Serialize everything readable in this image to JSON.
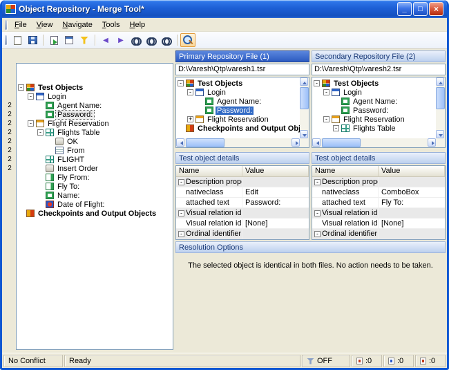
{
  "colors": {
    "titlebar_blue": "#1D5FD6",
    "selection_blue": "#316AC5",
    "primary_header_blue": "#2C5BC0",
    "light_header_blue": "#BCD0EE",
    "panel_face": "#ECE9D8"
  },
  "window": {
    "title": "Object Repository - Merge Tool*",
    "minimize_glyph": "_",
    "maximize_glyph": "□",
    "close_glyph": "×",
    "menu": [
      "File",
      "View",
      "Navigate",
      "Tools",
      "Help"
    ]
  },
  "toolbar": {
    "buttons": [
      {
        "dn": "new-icon",
        "cls": "tb-new"
      },
      {
        "dn": "save-icon",
        "cls": "tb-save"
      },
      {
        "dn": "toolbar-separator",
        "state": "tbsep",
        "ni": true
      },
      {
        "dn": "export-icon",
        "cls": "tb-doc"
      },
      {
        "dn": "statistics-icon",
        "cls": "tb-report"
      },
      {
        "dn": "filter-icon",
        "cls": "tb-filter"
      },
      {
        "dn": "toolbar-separator",
        "state": "tbsep",
        "ni": true
      },
      {
        "dn": "previous-conflict-icon",
        "cls": "tb-prev",
        "glyph": "◀"
      },
      {
        "dn": "next-conflict-icon",
        "cls": "tb-next",
        "glyph": "▶"
      },
      {
        "dn": "find-icon",
        "cls": "tb-find"
      },
      {
        "dn": "find-next-icon",
        "cls": "tb-find"
      },
      {
        "dn": "find-previous-icon",
        "cls": "tb-find"
      },
      {
        "dn": "toolbar-separator",
        "state": "tbsep",
        "ni": true
      },
      {
        "dn": "zoom-icon",
        "cls": "tb-zoom",
        "state": "active"
      }
    ]
  },
  "left_tree": {
    "gutter": [
      "",
      "",
      "2",
      "2",
      "2",
      "2",
      "2",
      "2",
      "2",
      "2",
      "",
      "",
      "",
      "",
      ""
    ],
    "rows": [
      {
        "lv": 0,
        "exp": "-",
        "icon": "i-root",
        "label": "Test Objects",
        "cls": "bold"
      },
      {
        "lv": 1,
        "exp": "-",
        "icon": "i-dialog",
        "label": "Login"
      },
      {
        "lv": 2,
        "exp": "",
        "icon": "i-edit",
        "label": "Agent Name:"
      },
      {
        "lv": 2,
        "exp": "",
        "icon": "i-edit",
        "label": "Password:",
        "cls": "focus"
      },
      {
        "lv": 1,
        "exp": "-",
        "icon": "i-window",
        "label": "Flight Reservation"
      },
      {
        "lv": 2,
        "exp": "-",
        "icon": "i-table",
        "label": "Flights Table"
      },
      {
        "lv": 3,
        "exp": "",
        "icon": "i-button",
        "label": "OK"
      },
      {
        "lv": 3,
        "exp": "",
        "icon": "i-list",
        "label": "From"
      },
      {
        "lv": 2,
        "exp": "",
        "icon": "i-table",
        "label": "FLIGHT"
      },
      {
        "lv": 2,
        "exp": "",
        "icon": "i-button",
        "label": "Insert Order"
      },
      {
        "lv": 2,
        "exp": "",
        "icon": "i-combo",
        "label": "Fly From:"
      },
      {
        "lv": 2,
        "exp": "",
        "icon": "i-combo",
        "label": "Fly To:"
      },
      {
        "lv": 2,
        "exp": "",
        "icon": "i-edit",
        "label": "Name:"
      },
      {
        "lv": 2,
        "exp": "",
        "icon": "i-ax",
        "label": "Date of Flight:"
      },
      {
        "lv": 0,
        "exp": "",
        "icon": "i-check",
        "label": "Checkpoints and Output Objects",
        "cls": "bold"
      }
    ]
  },
  "primary": {
    "header": "Primary Repository File (1)",
    "path": "D:\\Varesh\\Qtp\\varesh1.tsr",
    "tree": [
      {
        "lv": 0,
        "exp": "-",
        "icon": "i-root",
        "label": "Test Objects",
        "cls": "bold"
      },
      {
        "lv": 1,
        "exp": "-",
        "icon": "i-dialog",
        "label": "Login"
      },
      {
        "lv": 2,
        "exp": "",
        "icon": "i-edit",
        "label": "Agent Name:"
      },
      {
        "lv": 2,
        "exp": "",
        "icon": "i-edit",
        "label": "Password:",
        "cls": "sel"
      },
      {
        "lv": 1,
        "exp": "+",
        "icon": "i-window",
        "label": "Flight Reservation"
      },
      {
        "lv": 0,
        "exp": "",
        "icon": "i-check",
        "label": "Checkpoints and Output Objects",
        "cls": "bold"
      }
    ],
    "details_header": "Test object details",
    "table": {
      "columns": [
        "Name",
        "Value"
      ],
      "rows": [
        {
          "exp": "-",
          "name": "Description properties",
          "value": "",
          "cls": "group"
        },
        {
          "exp": "",
          "name": "nativeclass",
          "value": "Edit"
        },
        {
          "exp": "",
          "name": "attached text",
          "value": "Password:"
        },
        {
          "exp": "-",
          "name": "Visual relation identif...",
          "value": "",
          "cls": "group"
        },
        {
          "exp": "",
          "name": "Visual relation iden...",
          "value": "[None]"
        },
        {
          "exp": "-",
          "name": "Ordinal identifier",
          "value": "",
          "cls": "group"
        }
      ]
    }
  },
  "secondary": {
    "header": "Secondary Repository File (2)",
    "path": "D:\\Varesh\\Qtp\\varesh2.tsr",
    "tree": [
      {
        "lv": 0,
        "exp": "-",
        "icon": "i-root",
        "label": "Test Objects",
        "cls": "bold"
      },
      {
        "lv": 1,
        "exp": "-",
        "icon": "i-dialog",
        "label": "Login"
      },
      {
        "lv": 2,
        "exp": "",
        "icon": "i-edit",
        "label": "Agent Name:"
      },
      {
        "lv": 2,
        "exp": "",
        "icon": "i-edit",
        "label": "Password:"
      },
      {
        "lv": 1,
        "exp": "-",
        "icon": "i-window",
        "label": "Flight Reservation"
      },
      {
        "lv": 2,
        "exp": "-",
        "icon": "i-table",
        "label": "Flights Table"
      }
    ],
    "details_header": "Test object details",
    "table": {
      "columns": [
        "Name",
        "Value"
      ],
      "rows": [
        {
          "exp": "-",
          "name": "Description properties",
          "value": "",
          "cls": "group"
        },
        {
          "exp": "",
          "name": "nativeclass",
          "value": "ComboBox"
        },
        {
          "exp": "",
          "name": "attached text",
          "value": "Fly To:"
        },
        {
          "exp": "-",
          "name": "Visual relation identifi...",
          "value": "",
          "cls": "group"
        },
        {
          "exp": "",
          "name": "Visual relation iden...",
          "value": "[None]"
        },
        {
          "exp": "-",
          "name": "Ordinal identifier",
          "value": "",
          "cls": "group"
        }
      ]
    }
  },
  "resolution": {
    "header": "Resolution Options",
    "message": "The selected object is identical in both files. No action needs to be taken."
  },
  "statusbar": {
    "conflict": "No Conflict",
    "status": "Ready",
    "filter_label": "OFF",
    "counters": [
      {
        "cls": "sb-red",
        "count": ":0"
      },
      {
        "cls": "sb-blue",
        "count": ":0"
      },
      {
        "cls": "sb-red",
        "count": ":0"
      }
    ]
  }
}
